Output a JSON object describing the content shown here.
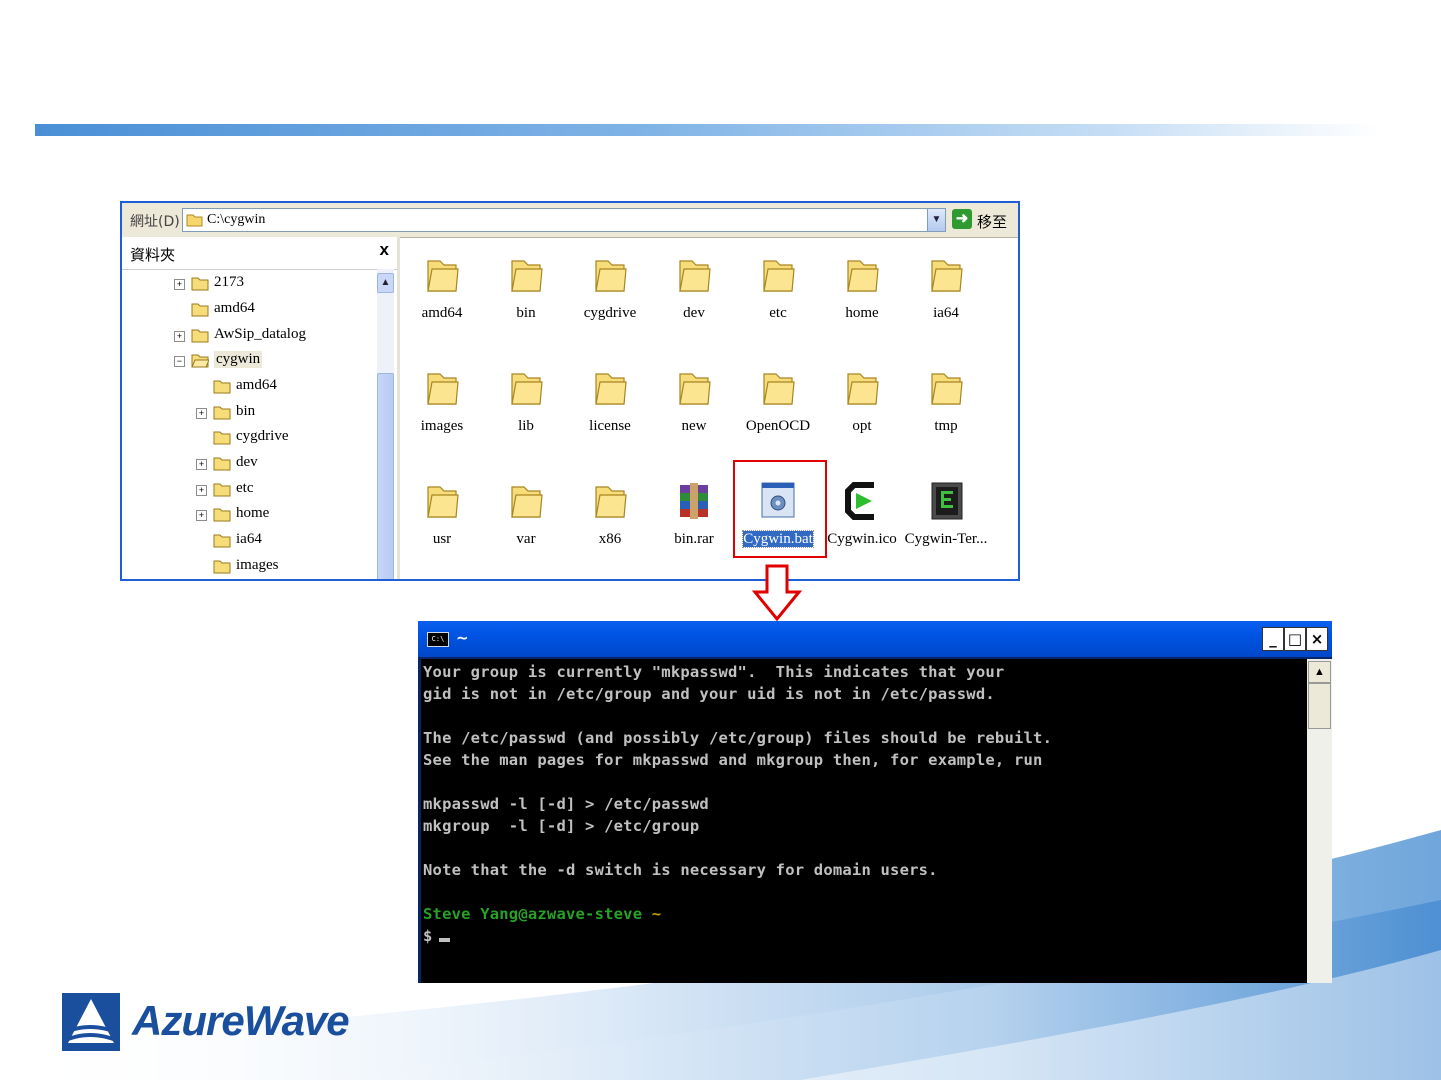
{
  "explorer": {
    "address_label": "網址(D)",
    "address_value": "C:\\cygwin",
    "go_label": "移至",
    "folder_pane_title": "資料夾",
    "tree": [
      {
        "label": "2173",
        "expander": "+"
      },
      {
        "label": "amd64",
        "expander": ""
      },
      {
        "label": "AwSip_datalog",
        "expander": "+"
      },
      {
        "label": "cygwin",
        "expander": "−"
      },
      {
        "label": "amd64",
        "expander": ""
      },
      {
        "label": "bin",
        "expander": "+"
      },
      {
        "label": "cygdrive",
        "expander": ""
      },
      {
        "label": "dev",
        "expander": "+"
      },
      {
        "label": "etc",
        "expander": "+"
      },
      {
        "label": "home",
        "expander": "+"
      },
      {
        "label": "ia64",
        "expander": ""
      },
      {
        "label": "images",
        "expander": ""
      }
    ],
    "files": [
      {
        "label": "amd64",
        "icon": "folder-icon"
      },
      {
        "label": "bin",
        "icon": "folder-icon"
      },
      {
        "label": "cygdrive",
        "icon": "folder-icon"
      },
      {
        "label": "dev",
        "icon": "folder-icon"
      },
      {
        "label": "etc",
        "icon": "folder-icon"
      },
      {
        "label": "home",
        "icon": "folder-icon"
      },
      {
        "label": "ia64",
        "icon": "folder-icon"
      },
      {
        "label": "images",
        "icon": "folder-icon"
      },
      {
        "label": "lib",
        "icon": "folder-icon"
      },
      {
        "label": "license",
        "icon": "folder-icon"
      },
      {
        "label": "new",
        "icon": "folder-icon"
      },
      {
        "label": "OpenOCD",
        "icon": "folder-icon"
      },
      {
        "label": "opt",
        "icon": "folder-icon"
      },
      {
        "label": "tmp",
        "icon": "folder-icon"
      },
      {
        "label": "usr",
        "icon": "folder-icon"
      },
      {
        "label": "var",
        "icon": "folder-icon"
      },
      {
        "label": "x86",
        "icon": "folder-icon"
      },
      {
        "label": "bin.rar",
        "icon": "rar-archive-icon"
      },
      {
        "label": "Cygwin.bat",
        "icon": "batch-file-icon",
        "selected": true
      },
      {
        "label": "Cygwin.ico",
        "icon": "cygwin-logo-icon"
      },
      {
        "label": "Cygwin-Ter...",
        "icon": "terminal-icon"
      }
    ]
  },
  "terminal": {
    "title": "~",
    "icon_text": "C:\\",
    "minimize": "_",
    "maximize": "□",
    "close": "×",
    "lines": [
      "Your group is currently \"mkpasswd\".  This indicates that your",
      "gid is not in /etc/group and your uid is not in /etc/passwd.",
      "",
      "The /etc/passwd (and possibly /etc/group) files should be rebuilt.",
      "See the man pages for mkpasswd and mkgroup then, for example, run",
      "",
      "mkpasswd -l [-d] > /etc/passwd",
      "mkgroup  -l [-d] > /etc/group",
      "",
      "Note that the -d switch is necessary for domain users."
    ],
    "prompt_user": "Steve Yang@azwave-steve",
    "prompt_dir": "~",
    "prompt_symbol": "$"
  },
  "logo": {
    "text": "AzureWave"
  },
  "colors": {
    "highlight": "#e00000",
    "brand_blue": "#1a4f9e",
    "xp_blue": "#0054e3"
  }
}
